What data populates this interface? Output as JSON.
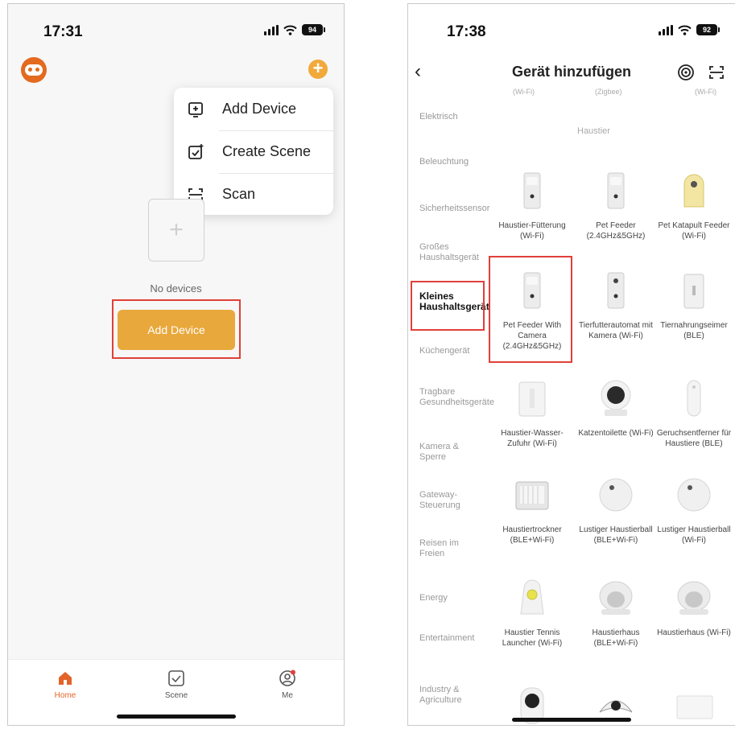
{
  "left": {
    "status_time": "17:31",
    "battery": "94",
    "menu": [
      {
        "label": "Add Device"
      },
      {
        "label": "Create Scene"
      },
      {
        "label": "Scan"
      }
    ],
    "empty_text": "No devices",
    "add_button": "Add Device",
    "tabs": [
      {
        "label": "Home"
      },
      {
        "label": "Scene"
      },
      {
        "label": "Me"
      }
    ]
  },
  "right": {
    "status_time": "17:38",
    "battery": "92",
    "title": "Gerät hinzufügen",
    "cut_labels": [
      "(Wi-Fi)",
      "(Zigbee)",
      "(Wi-Fi)"
    ],
    "section_title": "Haustier",
    "sidebar": [
      "Elektrisch",
      "Beleuchtung",
      "Sicherheitssensor",
      "Großes Haushaltsgerät",
      "Kleines Haushaltsgerät",
      "Küchengerät",
      "Tragbare Gesundheitsgeräte",
      "Kamera & Sperre",
      "Gateway-Steuerung",
      "Reisen im Freien",
      "Energy",
      "Entertainment",
      "Industry & Agriculture"
    ],
    "devices": [
      {
        "label": "Haustier-Fütterung (Wi-Fi)"
      },
      {
        "label": "Pet Feeder (2.4GHz&5GHz)"
      },
      {
        "label": "Pet Katapult Feeder (Wi-Fi)"
      },
      {
        "label": "Pet Feeder With Camera (2.4GHz&5GHz)"
      },
      {
        "label": "Tierfutterautomat mit Kamera (Wi-Fi)"
      },
      {
        "label": "Tiernahrungseimer (BLE)"
      },
      {
        "label": "Haustier-Wasser-Zufuhr (Wi-Fi)"
      },
      {
        "label": "Katzentoilette (Wi-Fi)"
      },
      {
        "label": "Geruchsentferner für Haustiere (BLE)"
      },
      {
        "label": "Haustiertrockner (BLE+Wi-Fi)"
      },
      {
        "label": "Lustiger Haustierball (BLE+Wi-Fi)"
      },
      {
        "label": "Lustiger Haustierball (Wi-Fi)"
      },
      {
        "label": "Haustier Tennis Launcher (Wi-Fi)"
      },
      {
        "label": "Haustierhaus (BLE+Wi-Fi)"
      },
      {
        "label": "Haustierhaus (Wi-Fi)"
      }
    ]
  },
  "colors": {
    "accent": "#e9a83b",
    "highlight": "#e0403a",
    "tab_active": "#e3642a"
  }
}
